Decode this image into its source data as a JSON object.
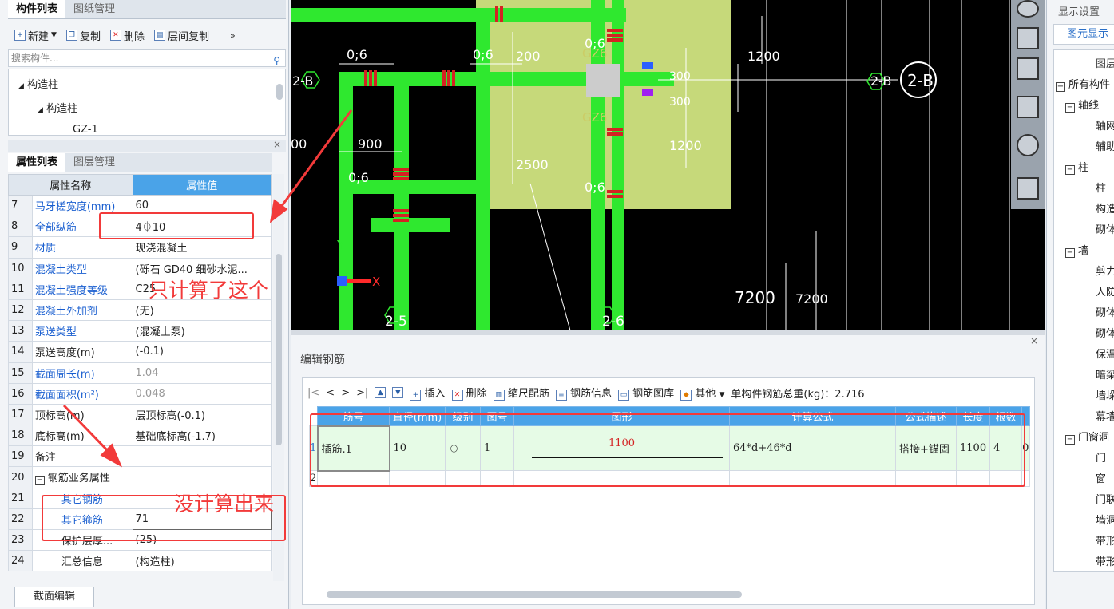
{
  "left": {
    "tabs_top": [
      "构件列表",
      "图纸管理"
    ],
    "toolbar": [
      "新建",
      "复制",
      "删除",
      "层间复制"
    ],
    "search_placeholder": "搜索构件...",
    "tree": [
      "构造柱",
      "构造柱",
      "GZ-1"
    ],
    "tabs_mid": [
      "属性列表",
      "图层管理"
    ],
    "headers": [
      "属性名称",
      "属性值"
    ],
    "rows": [
      {
        "num": "7",
        "name": "马牙槎宽度(mm)",
        "value": "60"
      },
      {
        "num": "8",
        "name": "全部纵筋",
        "value": "4⏀10"
      },
      {
        "num": "9",
        "name": "材质",
        "value": "现浇混凝土"
      },
      {
        "num": "10",
        "name": "混凝土类型",
        "value": "(砾石 GD40 细砂水泥..."
      },
      {
        "num": "11",
        "name": "混凝土强度等级",
        "value": "C25"
      },
      {
        "num": "12",
        "name": "混凝土外加剂",
        "value": "(无)"
      },
      {
        "num": "13",
        "name": "泵送类型",
        "value": "(混凝土泵)"
      },
      {
        "num": "14",
        "name": "泵送高度(m)",
        "value": "(-0.1)"
      },
      {
        "num": "15",
        "name": "截面周长(m)",
        "value": "1.04"
      },
      {
        "num": "16",
        "name": "截面面积(m²)",
        "value": "0.048"
      },
      {
        "num": "17",
        "name": "顶标高(m)",
        "value": "层顶标高(-0.1)"
      },
      {
        "num": "18",
        "name": "底标高(m)",
        "value": "基础底标高(-1.7)"
      },
      {
        "num": "19",
        "name": "备注",
        "value": ""
      },
      {
        "num": "20",
        "name": "钢筋业务属性",
        "value": ""
      },
      {
        "num": "21",
        "name": "其它钢筋",
        "value": ""
      },
      {
        "num": "22",
        "name": "其它箍筋",
        "value": "71"
      },
      {
        "num": "23",
        "name": "保护层厚...",
        "value": "(25)"
      },
      {
        "num": "24",
        "name": "汇总信息",
        "value": "(构造柱)"
      }
    ],
    "section_edit_button": "截面编辑"
  },
  "cad": {
    "labels": [
      "0;6",
      "0;6",
      "0;6",
      "2-B",
      "2-B",
      "2-B",
      "GZ6",
      "GZ6",
      "900",
      "200",
      "2500",
      "1200",
      "300",
      "300",
      "1200",
      "7200",
      "7200",
      "2-5",
      "2-6",
      "Y",
      "X",
      "00",
      "0;6",
      "0;6"
    ]
  },
  "rebar": {
    "title": "编辑钢筋",
    "toolbar": [
      "插入",
      "删除",
      "缩尺配筋",
      "钢筋信息",
      "钢筋图库",
      "其他",
      "单构件钢筋总重(kg)：2.716"
    ],
    "headers": [
      "筋号",
      "直径(mm)",
      "级别",
      "图号",
      "图形",
      "计算公式",
      "公式描述",
      "长度",
      "根数"
    ],
    "row": {
      "idx": "1",
      "name": "插筋.1",
      "dia": "10",
      "grade": "⏀",
      "fig": "1",
      "shape_len": "1100",
      "formula": "64*d+46*d",
      "desc": "搭接+锚固",
      "length": "1100",
      "count": "4",
      "extra": "0"
    },
    "row2_idx": "2"
  },
  "right": {
    "header": "显示设置",
    "subtab": "图元显示",
    "col": "图层",
    "items": [
      "所有构件",
      "轴线",
      "轴网",
      "辅助",
      "柱",
      "柱",
      "构造",
      "砌体",
      "墙",
      "剪力",
      "人防",
      "砌体",
      "砌体",
      "保温",
      "暗梁",
      "墙垛",
      "幕墙",
      "门窗洞",
      "门",
      "窗",
      "门联",
      "墙洞",
      "带形",
      "带形"
    ]
  },
  "annotations": {
    "only_calc": "只计算了这个",
    "not_calc": "没计算出来"
  },
  "colors": {
    "accent": "#4aa3e8",
    "link": "#1a5fd0",
    "annotation": "#f23a3a",
    "wall_green": "#2fe82f"
  }
}
